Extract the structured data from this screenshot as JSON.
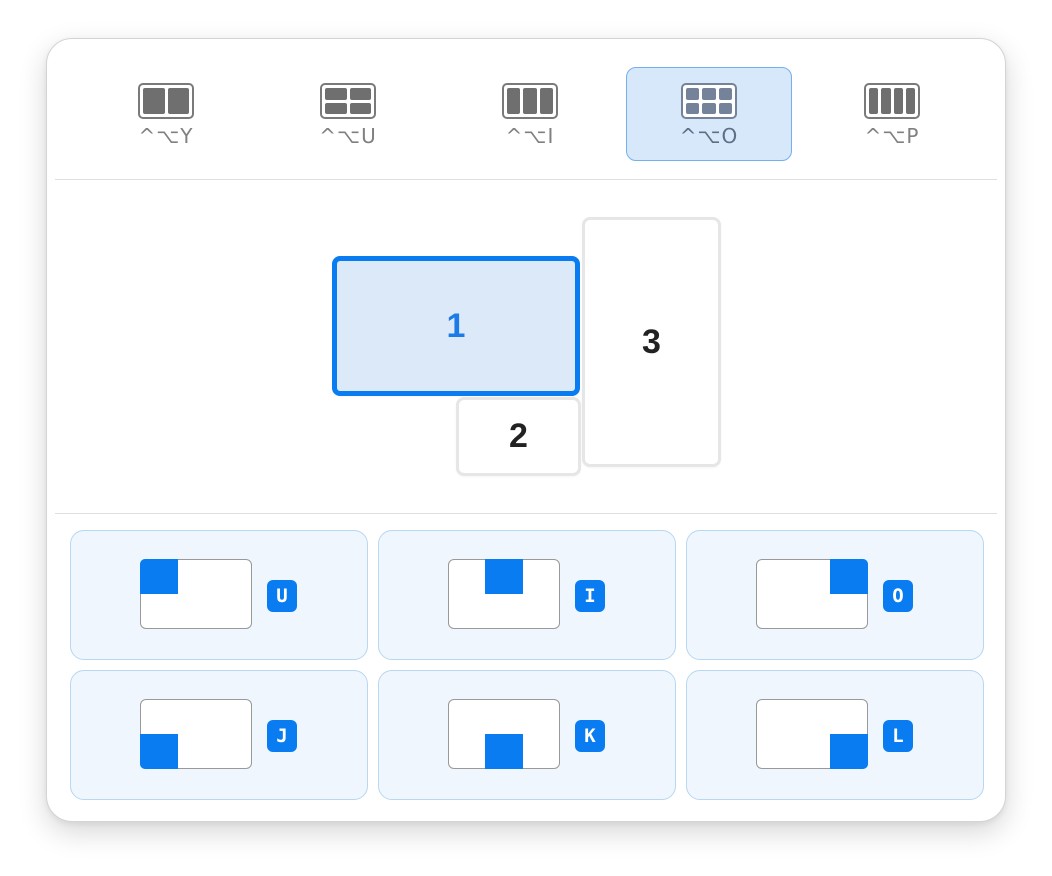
{
  "layouts": [
    {
      "id": "two-columns",
      "shortcut": "^⌥Y",
      "icon": "two-column-layout-icon",
      "selected": false
    },
    {
      "id": "two-by-two",
      "shortcut": "^⌥U",
      "icon": "two-by-two-grid-layout-icon",
      "selected": false
    },
    {
      "id": "three-columns",
      "shortcut": "^⌥I",
      "icon": "three-column-layout-icon",
      "selected": false
    },
    {
      "id": "three-by-two",
      "shortcut": "^⌥O",
      "icon": "three-by-two-grid-layout-icon",
      "selected": true
    },
    {
      "id": "four-columns",
      "shortcut": "^⌥P",
      "icon": "four-column-layout-icon",
      "selected": false
    }
  ],
  "screens": [
    {
      "label": "1",
      "active": true
    },
    {
      "label": "2",
      "active": false
    },
    {
      "label": "3",
      "active": false
    }
  ],
  "positions": [
    {
      "id": "top-left",
      "key": "U"
    },
    {
      "id": "top-center",
      "key": "I"
    },
    {
      "id": "top-right",
      "key": "O"
    },
    {
      "id": "bottom-left",
      "key": "J"
    },
    {
      "id": "bottom-center",
      "key": "K"
    },
    {
      "id": "bottom-right",
      "key": "L"
    }
  ],
  "colors": {
    "accent": "#0a7cf2",
    "selected_background": "#d7e8fb",
    "position_button_background": "#eff6fd"
  }
}
